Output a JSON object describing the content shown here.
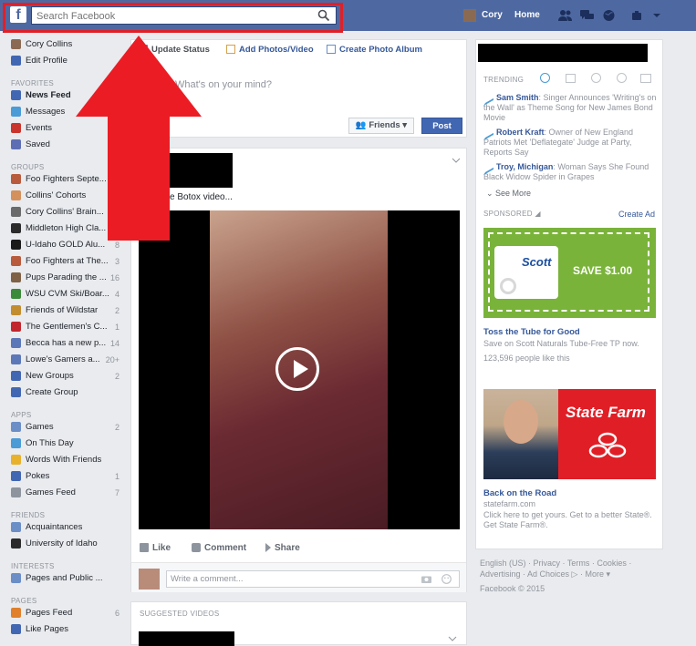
{
  "header": {
    "logo": "f",
    "search_placeholder": "Search Facebook",
    "user_name": "Cory",
    "home_label": "Home"
  },
  "leftnav": {
    "profile": [
      {
        "label": "Cory Collins",
        "icon": "avatar",
        "color": "#8b6a54"
      },
      {
        "label": "Edit Profile",
        "icon": "edit-icon",
        "color": "#4267b2"
      }
    ],
    "favorites_heading": "FAVORITES",
    "favorites": [
      {
        "label": "News Feed",
        "icon": "news-feed-icon",
        "color": "#4267b2",
        "bold": true
      },
      {
        "label": "Messages",
        "icon": "messages-icon",
        "color": "#4a9bd6"
      },
      {
        "label": "Events",
        "icon": "events-icon",
        "color": "#c9352c"
      },
      {
        "label": "Saved",
        "icon": "saved-icon",
        "color": "#5d6eb5"
      }
    ],
    "groups_heading": "GROUPS",
    "groups": [
      {
        "label": "Foo Fighters Septe...",
        "count": "",
        "color": "#b85b3d"
      },
      {
        "label": "Collins' Cohorts",
        "count": "",
        "color": "#d4915c"
      },
      {
        "label": "Cory Collins' Brain...",
        "count": "",
        "color": "#6b6b6b"
      },
      {
        "label": "Middleton High Cla...",
        "count": "2",
        "color": "#2b2b2b"
      },
      {
        "label": "U-Idaho GOLD Alu...",
        "count": "8",
        "color": "#1a1a1a"
      },
      {
        "label": "Foo Fighters at The...",
        "count": "3",
        "color": "#b85b3d"
      },
      {
        "label": "Pups Parading the ...",
        "count": "16",
        "color": "#7f6146"
      },
      {
        "label": "WSU CVM Ski/Boar...",
        "count": "4",
        "color": "#3b8a3a"
      },
      {
        "label": "Friends of Wildstar",
        "count": "2",
        "color": "#c28d2e"
      },
      {
        "label": "The Gentlemen's C...",
        "count": "1",
        "color": "#c1272d"
      },
      {
        "label": "Becca has a new p...",
        "count": "14",
        "color": "#5b77b8"
      },
      {
        "label": "Lowe's Gamers a...",
        "count": "20+",
        "color": "#5b77b8"
      },
      {
        "label": "New Groups",
        "count": "2",
        "color": "#4267b2"
      },
      {
        "label": "Create Group",
        "count": "",
        "color": "#4267b2"
      }
    ],
    "apps_heading": "APPS",
    "apps": [
      {
        "label": "Games",
        "count": "2",
        "color": "#6b8ec7"
      },
      {
        "label": "On This Day",
        "count": "",
        "color": "#4a9bd6"
      },
      {
        "label": "Words With Friends",
        "count": "",
        "color": "#e8b12c"
      },
      {
        "label": "Pokes",
        "count": "1",
        "color": "#4267b2"
      },
      {
        "label": "Games Feed",
        "count": "7",
        "color": "#8d949e"
      }
    ],
    "friends_heading": "FRIENDS",
    "friends": [
      {
        "label": "Acquaintances",
        "count": "",
        "color": "#6b8ec7"
      },
      {
        "label": "University of Idaho",
        "count": "",
        "color": "#2b2b2b"
      }
    ],
    "interests_heading": "INTERESTS",
    "interests": [
      {
        "label": "Pages and Public ...",
        "count": "",
        "color": "#6b8ec7"
      }
    ],
    "pages_heading": "PAGES",
    "pages": [
      {
        "label": "Pages Feed",
        "count": "6",
        "color": "#e0802c"
      },
      {
        "label": "Like Pages",
        "count": "",
        "color": "#4267b2"
      }
    ]
  },
  "composer": {
    "update_status": "Update Status",
    "add_photos": "Add Photos/Video",
    "create_album": "Create Photo Album",
    "placeholder": "What's on your mind?",
    "audience": "Friends",
    "post_label": "Post"
  },
  "post": {
    "text": "ittle Botox video...",
    "like": "Like",
    "comment": "Comment",
    "share": "Share",
    "comment_placeholder": "Write a comment..."
  },
  "suggested": {
    "title": "SUGGESTED VIDEOS"
  },
  "trending": {
    "heading": "TRENDING",
    "items": [
      {
        "name": "Sam Smith",
        "text": ": Singer Announces 'Writing's on the Wall' as Theme Song for New James Bond Movie"
      },
      {
        "name": "Robert Kraft",
        "text": ": Owner of New England Patriots Met 'Deflategate' Judge at Party, Reports Say"
      },
      {
        "name": "Troy, Michigan",
        "text": ": Woman Says She Found Black Widow Spider in Grapes"
      }
    ],
    "see_more": "See More"
  },
  "sponsored": {
    "heading": "SPONSORED",
    "create_ad": "Create Ad",
    "ad1": {
      "pack_brand": "Scott",
      "save_text": "SAVE $1.00",
      "title": "Toss the Tube for Good",
      "sub": "Save on Scott Naturals Tube-Free TP now.",
      "likes": "123,596 people like this"
    },
    "ad2": {
      "brand": "State Farm",
      "title": "Back on the Road",
      "domain": "statefarm.com",
      "sub": "Click here to get yours. Get to a better State®. Get State Farm®."
    }
  },
  "footer": {
    "line1": "English (US) · Privacy · Terms · Cookies ·",
    "line2": "Advertising · Ad Choices ▷ · More ▾",
    "line3": "Facebook © 2015"
  },
  "colors": {
    "topbar": "#4e69a2",
    "accent": "#4267b2",
    "highlight": "#e02027"
  }
}
